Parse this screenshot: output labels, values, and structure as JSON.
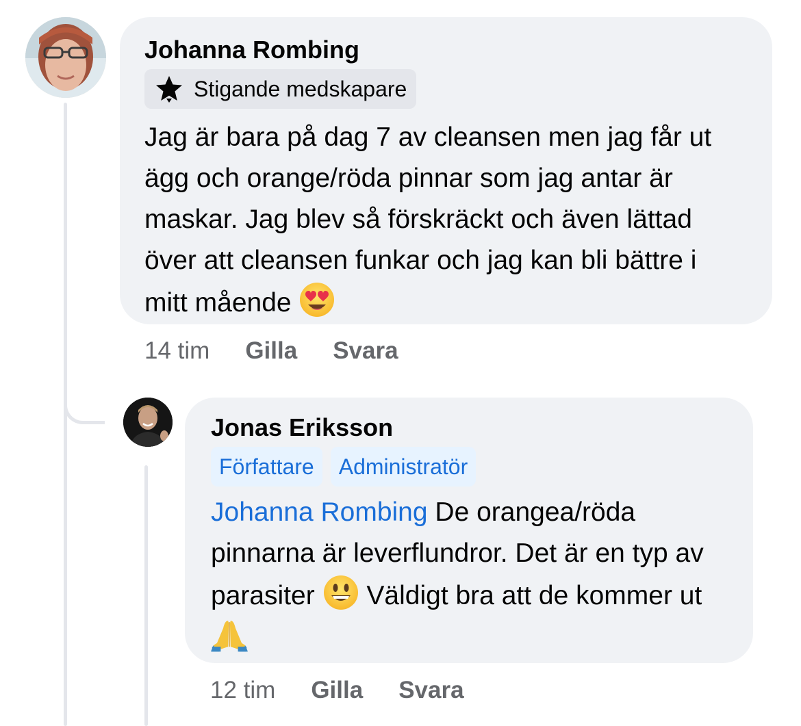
{
  "comments": [
    {
      "author": "Johanna Rombing",
      "avatar_icon": "profile-photo",
      "badges": [
        {
          "icon": "star-icon",
          "label": "Stigande medskapare"
        }
      ],
      "text": "Jag är bara på dag 7 av cleansen men jag får ut ägg och orange/röda pinnar som jag antar är maskar. Jag blev så förskräckt och även lättad över att cleansen funkar och jag kan bli bättre i mitt mående",
      "emoji": "heart-eyes-emoji",
      "time": "14 tim",
      "like_label": "Gilla",
      "reply_label": "Svara"
    },
    {
      "author": "Jonas Eriksson",
      "avatar_icon": "profile-photo",
      "badges": [
        {
          "label": "Författare"
        },
        {
          "label": "Administratör"
        }
      ],
      "mention": "Johanna Rombing",
      "text_part1": " De orangea/röda pinnarna är leverflundror. Det är en typ av parasiter ",
      "emoji1": "smiley-emoji",
      "text_part2": " Väldigt bra att de kommer ut ",
      "emoji2": "folded-hands-emoji",
      "time": "12 tim",
      "like_label": "Gilla",
      "reply_label": "Svara"
    }
  ],
  "colors": {
    "bubble": "#f0f2f5",
    "meta_text": "#65676b",
    "mention": "#1a6ed8",
    "badge_blue_bg": "#e7f3ff",
    "thread_line": "#e4e6eb"
  }
}
